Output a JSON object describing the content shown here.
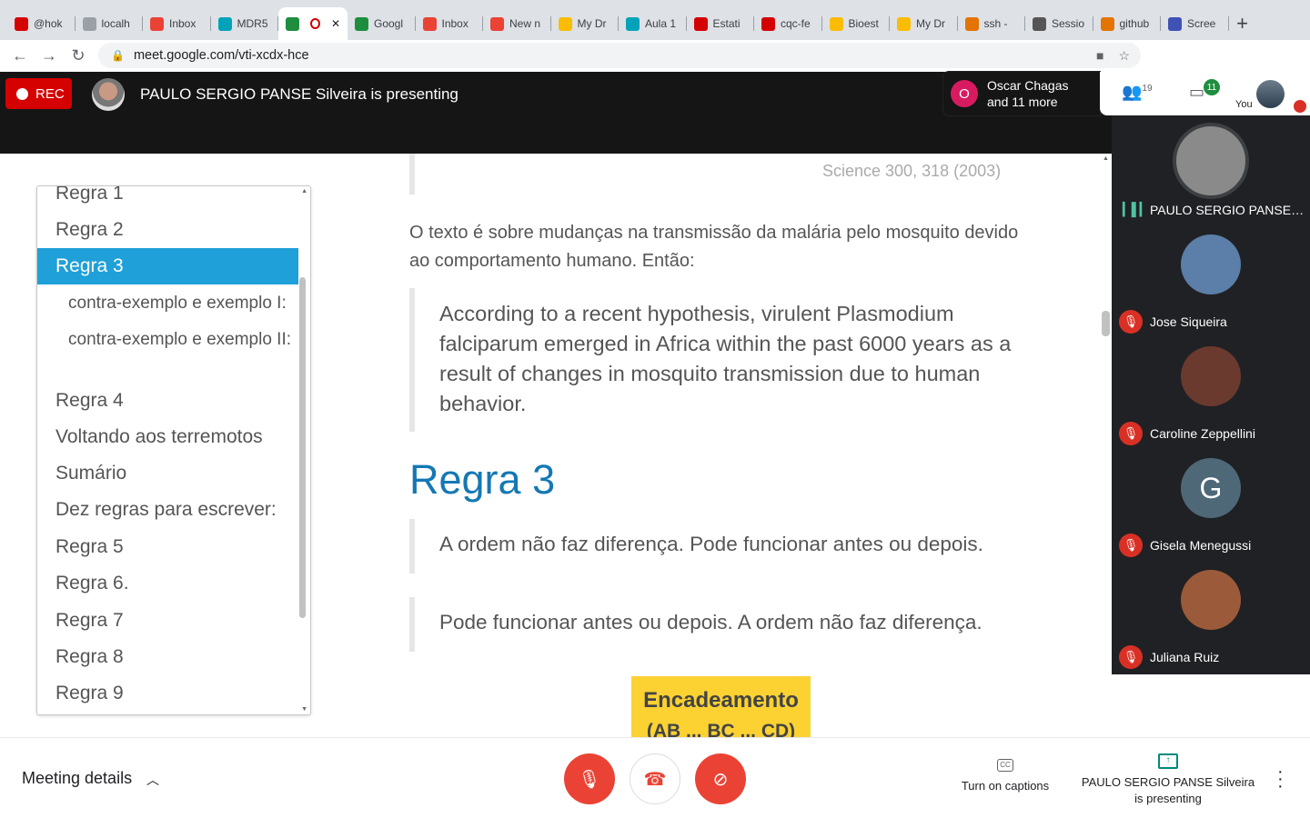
{
  "browser": {
    "tabs": [
      {
        "title": "@hok",
        "color": "#d50000"
      },
      {
        "title": "localh",
        "color": "#9aa0a6"
      },
      {
        "title": "Inbox",
        "color": "#ea4335"
      },
      {
        "title": "MDR5",
        "color": "#00a3ba"
      },
      {
        "title": "",
        "color": "#1e8e3e",
        "active": true
      },
      {
        "title": "Googl",
        "color": "#1e8e3e"
      },
      {
        "title": "Inbox",
        "color": "#ea4335"
      },
      {
        "title": "New n",
        "color": "#ea4335"
      },
      {
        "title": "My Dr",
        "color": "#fbbc04"
      },
      {
        "title": "Aula 1",
        "color": "#00a3ba"
      },
      {
        "title": "Estati",
        "color": "#d50000"
      },
      {
        "title": "cqc-fe",
        "color": "#d50000"
      },
      {
        "title": "Bioest",
        "color": "#fbbc04"
      },
      {
        "title": "My Dr",
        "color": "#fbbc04"
      },
      {
        "title": "ssh -",
        "color": "#e37400"
      },
      {
        "title": "Sessio",
        "color": "#555"
      },
      {
        "title": "github",
        "color": "#e37400"
      },
      {
        "title": "Scree",
        "color": "#3f51b5"
      }
    ],
    "url": "meet.google.com/vti-xcdx-hce"
  },
  "meet": {
    "rec_label": "REC",
    "presenting_text": "PAULO SERGIO PANSE Silveira is presenting",
    "oscar_initial": "O",
    "oscar_line1": "Oscar Chagas",
    "oscar_line2": "and 11 more",
    "people_count": "19",
    "chat_badge": "11",
    "you_label": "You"
  },
  "slide": {
    "toc": [
      {
        "label": "Regra 1"
      },
      {
        "label": "Regra 2"
      },
      {
        "label": "Regra 3",
        "selected": true
      },
      {
        "label": "contra-exemplo e exemplo I:",
        "sub": true
      },
      {
        "label": "contra-exemplo e exemplo II:",
        "sub": true
      },
      {
        "label": "Regra 4"
      },
      {
        "label": "Voltando aos terremotos"
      },
      {
        "label": "Sumário"
      },
      {
        "label": "Dez regras para escrever:"
      },
      {
        "label": "Regra 5"
      },
      {
        "label": "Regra 6."
      },
      {
        "label": "Regra 7"
      },
      {
        "label": "Regra 8"
      },
      {
        "label": "Regra 9"
      }
    ],
    "cite": "Science 300, 318 (2003)",
    "para": "O texto é sobre mudanças na transmissão da malária pelo mosquito devido ao comportamento humano. Então:",
    "blockquote": "According to a recent hypothesis, virulent Plasmodium falciparum emerged in Africa within the past 6000 years as a result of changes in mosquito transmission due to human behavior.",
    "heading": "Regra 3",
    "quote2": "A ordem não faz diferença. Pode funcionar antes ou depois.",
    "quote3": "Pode funcionar antes ou depois. A ordem não faz diferença.",
    "yellow_title": "Encadeamento",
    "yellow_sub": "(AB ... BC ... CD)"
  },
  "participants": [
    {
      "name": "PAULO SERGIO PANSE Silveira",
      "speaking": true,
      "avatar_color": "#8a8a8a"
    },
    {
      "name": "Jose Siqueira",
      "muted": true,
      "avatar_color": "#5b7fa8"
    },
    {
      "name": "Caroline Zeppellini",
      "muted": true,
      "avatar_color": "#6b3a2e"
    },
    {
      "name": "Gisela Menegussi",
      "muted": true,
      "initial": "G",
      "avatar_color": "#4e6878"
    },
    {
      "name": "Juliana Ruiz",
      "muted": true,
      "avatar_color": "#9b5a3a"
    }
  ],
  "bottom": {
    "meeting_details": "Meeting details",
    "captions_label": "Turn on captions",
    "presenting_label": "PAULO SERGIO PANSE Silveira is presenting"
  }
}
